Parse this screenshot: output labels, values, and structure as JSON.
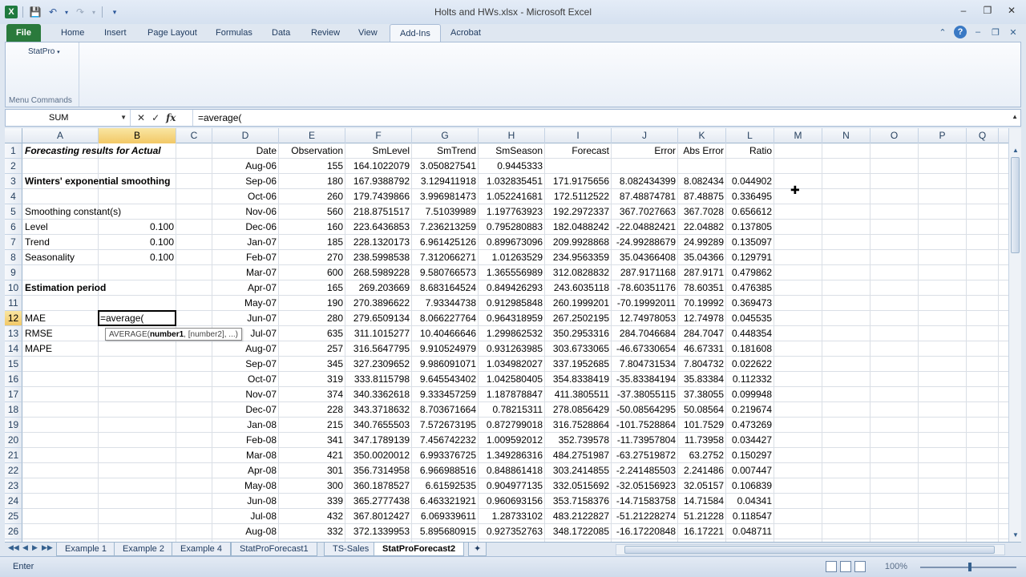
{
  "window": {
    "title": "Holts and HWs.xlsx - Microsoft Excel",
    "app_icon": "X"
  },
  "ribbon_tabs": [
    "File",
    "Home",
    "Insert",
    "Page Layout",
    "Formulas",
    "Data",
    "Review",
    "View",
    "Add-Ins",
    "Acrobat"
  ],
  "active_tab": "Add-Ins",
  "ribbon": {
    "statpro_label": "StatPro",
    "group_label": "Menu Commands"
  },
  "formula_bar": {
    "name_box": "SUM",
    "fx": "fx",
    "formula": "=average("
  },
  "columns": [
    "A",
    "B",
    "C",
    "D",
    "E",
    "F",
    "G",
    "H",
    "I",
    "J",
    "K",
    "L",
    "M",
    "N",
    "O",
    "P",
    "Q"
  ],
  "selected_column": "B",
  "rows": [
    1,
    2,
    3,
    4,
    5,
    6,
    7,
    8,
    9,
    10,
    11,
    12,
    13,
    14,
    15,
    16,
    17,
    18,
    19,
    20,
    21,
    22,
    23,
    24,
    25,
    26,
    27
  ],
  "selected_row": 12,
  "left_cells": [
    {
      "row": 1,
      "col": "A",
      "text": "Forecasting results for Actual",
      "style": "bi"
    },
    {
      "row": 3,
      "col": "A",
      "text": "Winters' exponential smoothing",
      "style": "b"
    },
    {
      "row": 5,
      "col": "A",
      "text": "Smoothing constant(s)",
      "style": ""
    },
    {
      "row": 6,
      "col": "A",
      "text": "Level",
      "style": ""
    },
    {
      "row": 6,
      "col": "B",
      "text": "0.100",
      "style": "r"
    },
    {
      "row": 7,
      "col": "A",
      "text": "Trend",
      "style": ""
    },
    {
      "row": 7,
      "col": "B",
      "text": "0.100",
      "style": "r"
    },
    {
      "row": 8,
      "col": "A",
      "text": "Seasonality",
      "style": ""
    },
    {
      "row": 8,
      "col": "B",
      "text": "0.100",
      "style": "r"
    },
    {
      "row": 10,
      "col": "A",
      "text": "Estimation period",
      "style": "b"
    },
    {
      "row": 12,
      "col": "A",
      "text": "MAE",
      "style": ""
    },
    {
      "row": 13,
      "col": "A",
      "text": "RMSE",
      "style": ""
    },
    {
      "row": 14,
      "col": "A",
      "text": "MAPE",
      "style": ""
    }
  ],
  "active_cell_text": "=average(",
  "tooltip": {
    "fn": "AVERAGE(",
    "arg1": "number1",
    "rest": ", [number2], ...)"
  },
  "table_headers": [
    "Date",
    "Observation",
    "SmLevel",
    "SmTrend",
    "SmSeason",
    "Forecast",
    "Error",
    "Abs Error",
    "Ratio"
  ],
  "table_rows": [
    [
      "Aug-06",
      "155",
      "164.1022079",
      "3.050827541",
      "0.9445333",
      "",
      "",
      "",
      ""
    ],
    [
      "Sep-06",
      "180",
      "167.9388792",
      "3.129411918",
      "1.032835451",
      "171.9175656",
      "8.082434399",
      "8.082434",
      "0.044902"
    ],
    [
      "Oct-06",
      "260",
      "179.7439866",
      "3.996981473",
      "1.052241681",
      "172.5112522",
      "87.48874781",
      "87.48875",
      "0.336495"
    ],
    [
      "Nov-06",
      "560",
      "218.8751517",
      "7.51039989",
      "1.197763923",
      "192.2972337",
      "367.7027663",
      "367.7028",
      "0.656612"
    ],
    [
      "Dec-06",
      "160",
      "223.6436853",
      "7.236213259",
      "0.795280883",
      "182.0488242",
      "-22.04882421",
      "22.04882",
      "0.137805"
    ],
    [
      "Jan-07",
      "185",
      "228.1320173",
      "6.961425126",
      "0.899673096",
      "209.9928868",
      "-24.99288679",
      "24.99289",
      "0.135097"
    ],
    [
      "Feb-07",
      "270",
      "238.5998538",
      "7.312066271",
      "1.01263529",
      "234.9563359",
      "35.04366408",
      "35.04366",
      "0.129791"
    ],
    [
      "Mar-07",
      "600",
      "268.5989228",
      "9.580766573",
      "1.365556989",
      "312.0828832",
      "287.9171168",
      "287.9171",
      "0.479862"
    ],
    [
      "Apr-07",
      "165",
      "269.203669",
      "8.683164524",
      "0.849426293",
      "243.6035118",
      "-78.60351176",
      "78.60351",
      "0.476385"
    ],
    [
      "May-07",
      "190",
      "270.3896622",
      "7.93344738",
      "0.912985848",
      "260.1999201",
      "-70.19992011",
      "70.19992",
      "0.369473"
    ],
    [
      "Jun-07",
      "280",
      "279.6509134",
      "8.066227764",
      "0.964318959",
      "267.2502195",
      "12.74978053",
      "12.74978",
      "0.045535"
    ],
    [
      "Jul-07",
      "635",
      "311.1015277",
      "10.40466646",
      "1.299862532",
      "350.2953316",
      "284.7046684",
      "284.7047",
      "0.448354"
    ],
    [
      "Aug-07",
      "257",
      "316.5647795",
      "9.910524979",
      "0.931263985",
      "303.6733065",
      "-46.67330654",
      "46.67331",
      "0.181608"
    ],
    [
      "Sep-07",
      "345",
      "327.2309652",
      "9.986091071",
      "1.034982027",
      "337.1952685",
      "7.804731534",
      "7.804732",
      "0.022622"
    ],
    [
      "Oct-07",
      "319",
      "333.8115798",
      "9.645543402",
      "1.042580405",
      "354.8338419",
      "-35.83384194",
      "35.83384",
      "0.112332"
    ],
    [
      "Nov-07",
      "374",
      "340.3362618",
      "9.333457259",
      "1.187878847",
      "411.3805511",
      "-37.38055115",
      "37.38055",
      "0.099948"
    ],
    [
      "Dec-07",
      "228",
      "343.3718632",
      "8.703671664",
      "0.78215311",
      "278.0856429",
      "-50.08564295",
      "50.08564",
      "0.219674"
    ],
    [
      "Jan-08",
      "215",
      "340.7655503",
      "7.572673195",
      "0.872799018",
      "316.7528864",
      "-101.7528864",
      "101.7529",
      "0.473269"
    ],
    [
      "Feb-08",
      "341",
      "347.1789139",
      "7.456742232",
      "1.009592012",
      "352.739578",
      "-11.73957804",
      "11.73958",
      "0.034427"
    ],
    [
      "Mar-08",
      "421",
      "350.0020012",
      "6.993376725",
      "1.349286316",
      "484.2751987",
      "-63.27519872",
      "63.2752",
      "0.150297"
    ],
    [
      "Apr-08",
      "301",
      "356.7314958",
      "6.966988516",
      "0.848861418",
      "303.2414855",
      "-2.241485503",
      "2.241486",
      "0.007447"
    ],
    [
      "May-08",
      "300",
      "360.1878527",
      "6.61592535",
      "0.904977135",
      "332.0515692",
      "-32.05156923",
      "32.05157",
      "0.106839"
    ],
    [
      "Jun-08",
      "339",
      "365.2777438",
      "6.463321921",
      "0.960693156",
      "353.7158376",
      "-14.71583758",
      "14.71584",
      "0.04341"
    ],
    [
      "Jul-08",
      "432",
      "367.8012427",
      "6.069339611",
      "1.28733102",
      "483.2122827",
      "-51.21228274",
      "51.21228",
      "0.118547"
    ],
    [
      "Aug-08",
      "332",
      "372.1339953",
      "5.895680915",
      "0.927352763",
      "348.1722085",
      "-16.17220848",
      "16.17221",
      "0.048711"
    ]
  ],
  "sheet_tabs": [
    "Example 1",
    "Example 2",
    "Example 4",
    "StatProForecast1",
    "TS-Sales",
    "StatProForecast2"
  ],
  "active_sheet": "StatProForecast2",
  "status": {
    "mode": "Enter",
    "zoom": "100%"
  }
}
